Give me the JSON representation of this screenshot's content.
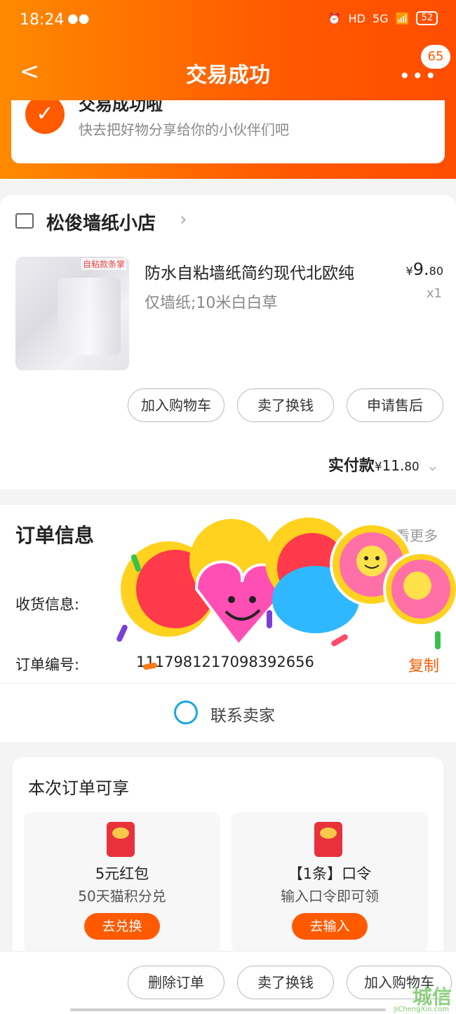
{
  "status": {
    "time": "18:24",
    "battery": "52",
    "network": "5G",
    "hd": "HD"
  },
  "nav": {
    "title": "交易成功",
    "badge": "65"
  },
  "success": {
    "title": "交易成功啦",
    "subtitle": "快去把好物分享给你的小伙伴们吧"
  },
  "shop": {
    "name": "松俊墙纸小店"
  },
  "product": {
    "title": "防水自粘墙纸简约现代北欧纯",
    "spec": "仅墙纸;10米白白草",
    "price_symbol": "¥",
    "price_int": "9.",
    "price_dec": "80",
    "qty": "x1",
    "tag": "自粘款条掌"
  },
  "product_actions": [
    "加入购物车",
    "卖了换钱",
    "申请售后"
  ],
  "payment": {
    "label": "实付款",
    "symbol": "¥",
    "int": "11.",
    "dec": "80"
  },
  "order": {
    "title": "订单信息",
    "view_more": "查看更多",
    "shipping_label": "收货信息:",
    "number_label": "订单编号:",
    "number_value": "1117981217098392656",
    "copy": "复制"
  },
  "contact": {
    "label": "联系卖家"
  },
  "benefits": {
    "title": "本次订单可享",
    "items": [
      {
        "title": "5元红包",
        "subtitle": "50天猫积分兑",
        "button": "去兑换"
      },
      {
        "title": "【1条】口令",
        "subtitle": "输入口令即可领",
        "button": "去输入"
      }
    ]
  },
  "bottom_actions": [
    "删除订单",
    "卖了换钱",
    "加入购物车"
  ],
  "watermark": {
    "text": "城信",
    "sub": "JiChengXin.com"
  },
  "colors": {
    "brand": "#ff5a00",
    "header_gradient_start": "#ff8a00",
    "contact": "#1aa7e0"
  }
}
